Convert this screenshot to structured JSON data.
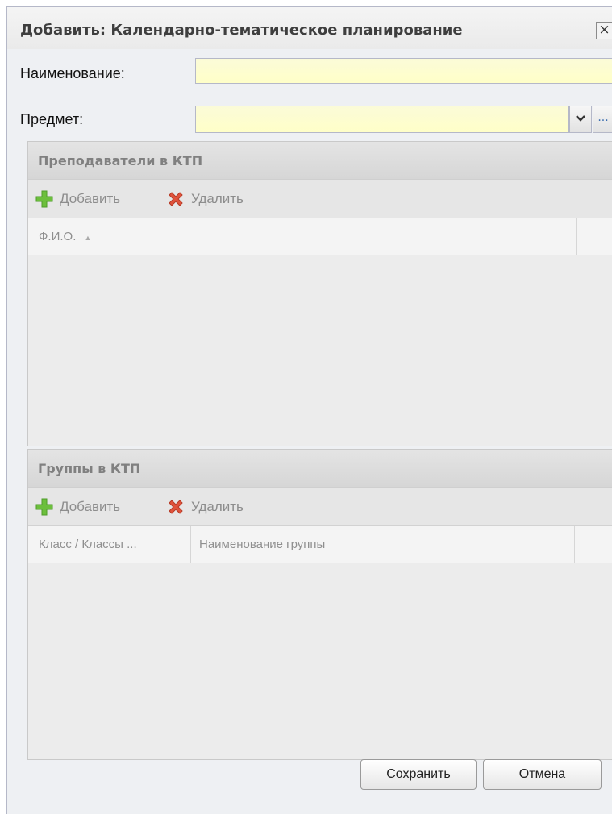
{
  "dialog": {
    "title": "Добавить: Календарно-тематическое планирование",
    "close_glyph": "×"
  },
  "form": {
    "name_label": "Наименование:",
    "name_value": "",
    "subject_label": "Предмет:",
    "subject_value": "",
    "subject_dropdown_icon": "chevron-down-icon",
    "subject_more_label": "..."
  },
  "teachers_panel": {
    "title": "Преподаватели в КТП",
    "add_label": "Добавить",
    "delete_label": "Удалить",
    "columns": [
      {
        "label": "Ф.И.О.",
        "sort_indicator": "▲"
      }
    ],
    "rows": []
  },
  "groups_panel": {
    "title": "Группы в КТП",
    "add_label": "Добавить",
    "delete_label": "Удалить",
    "columns": [
      {
        "label": "Класс / Классы ..."
      },
      {
        "label": "Наименование группы"
      }
    ],
    "rows": []
  },
  "footer": {
    "save_label": "Сохранить",
    "cancel_label": "Отмена"
  },
  "colors": {
    "required_field_bg": "#ffffc8",
    "add_icon": "#6cbf3c",
    "delete_icon": "#e0533c"
  }
}
